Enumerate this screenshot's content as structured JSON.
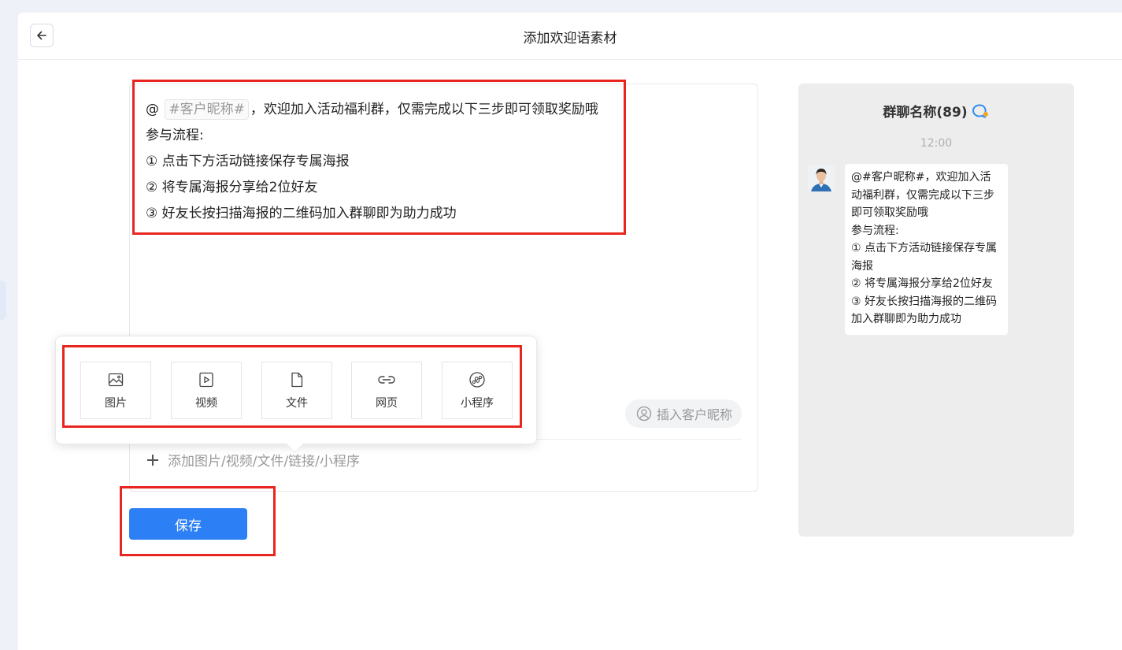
{
  "header": {
    "title": "添加欢迎语素材",
    "back_icon": "arrow-left-icon"
  },
  "editor": {
    "line1_prefix": "@",
    "nickname_tag": "#客户昵称#",
    "line1_suffix": "，欢迎加入活动福利群，仅需完成以下三步即可领取奖励哦",
    "lines": [
      "参与流程:",
      "① 点击下方活动链接保存专属海报",
      "② 将专属海报分享给2位好友",
      "③ 好友长按扫描海报的二维码加入群聊即为助力成功"
    ],
    "insert_nickname_label": "插入客户昵称",
    "add_attachment_label": "添加图片/视频/文件/链接/小程序"
  },
  "attachment_menu": {
    "items": [
      {
        "label": "图片",
        "icon": "image-icon"
      },
      {
        "label": "视频",
        "icon": "video-icon"
      },
      {
        "label": "文件",
        "icon": "file-icon"
      },
      {
        "label": "网页",
        "icon": "link-icon"
      },
      {
        "label": "小程序",
        "icon": "mini-program-icon"
      }
    ]
  },
  "save_label": "保存",
  "preview": {
    "group_title": "群聊名称(89)",
    "time": "12:00",
    "bubble_lines": [
      "@#客户昵称#，欢迎加入活动福利群，仅需完成以下三步即可领取奖励哦",
      "参与流程:",
      "① 点击下方活动链接保存专属海报",
      "② 将专属海报分享给2位好友",
      "③ 好友长按扫描海报的二维码加入群聊即为助力成功"
    ]
  },
  "colors": {
    "primary": "#2d7ff6",
    "highlight": "#e8261f",
    "preview_bg": "#ededed"
  }
}
